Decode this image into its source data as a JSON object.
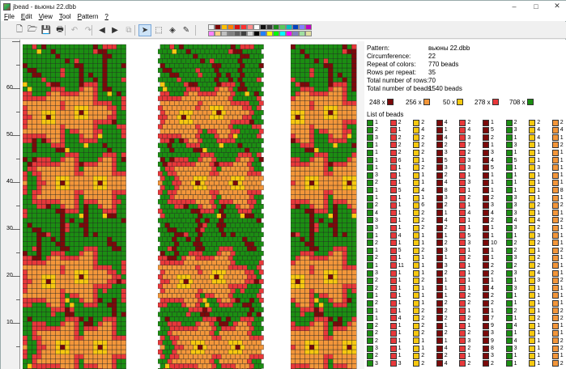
{
  "window": {
    "title": "jbead - вьюны 22.dbb"
  },
  "menu": [
    {
      "u": "F",
      "rest": "ile"
    },
    {
      "u": "E",
      "rest": "dit"
    },
    {
      "u": "V",
      "rest": "iew"
    },
    {
      "u": "T",
      "rest": "ool"
    },
    {
      "u": "P",
      "rest": "attern"
    },
    {
      "u": "?",
      "rest": ""
    }
  ],
  "toolbar": {
    "buttons": [
      "new-file-icon",
      "open-folder-icon",
      "save-icon",
      "print-icon",
      "undo-icon",
      "redo-icon",
      "scroll-left-icon",
      "scroll-right-icon",
      "copy-icon",
      "pointer-icon",
      "select-icon",
      "fill-icon",
      "pipette-icon"
    ],
    "selected": "pointer-icon",
    "palette": [
      "#f0f0f0",
      "#7a0000",
      "#ffc000",
      "#ff8000",
      "#dd1010",
      "#ff3030",
      "#ff8c8c",
      "#ffffff",
      "#111111",
      "#3a3a3a",
      "#1a8a1a",
      "#5ac85a",
      "#00c0c0",
      "#0040c0",
      "#8080ff",
      "#c000c0",
      "#ff80ff",
      "#ffd080",
      "#c0c0c0",
      "#808080",
      "#606060",
      "#404040",
      "#d8d8d8",
      "#000000",
      "#2080ff",
      "#ffff00",
      "#00ff00",
      "#00ffff",
      "#ff00ff",
      "#8080c0",
      "#a0e0a0",
      "#e0e0a0"
    ]
  },
  "colors": {
    "green": "#1b8e12",
    "darkred": "#7b0a0a",
    "orange": "#f3963a",
    "red": "#e8383a",
    "yellow": "#f7c80f",
    "white": "#ffffff"
  },
  "ruler": {
    "labels": [
      "60",
      "50",
      "40",
      "30",
      "20",
      "10"
    ]
  },
  "info": {
    "pattern_label": "Pattern:",
    "pattern": "вьюны 22.dbb",
    "circ_label": "Circumference:",
    "circ": "22",
    "repeat_label": "Repeat of colors:",
    "repeat": "770 beads",
    "rows_repeat_label": "Rows per repeat:",
    "rows_repeat": "35",
    "rows_label": "Total number of rows:",
    "rows": "70",
    "beads_label": "Total number of beads:",
    "beads": "1540 beads",
    "summary": [
      {
        "count": "248 x",
        "color": "darkred"
      },
      {
        "count": "256 x",
        "color": "orange"
      },
      {
        "count": "50 x",
        "color": "yellow"
      },
      {
        "count": "278 x",
        "color": "red"
      },
      {
        "count": "708 x",
        "color": "green"
      }
    ],
    "list_label": "List of beads",
    "list": [
      [
        [
          "green",
          "1"
        ],
        [
          "green",
          "2"
        ],
        [
          "green",
          "3"
        ],
        [
          "green",
          "1"
        ],
        [
          "green",
          "1"
        ],
        [
          "green",
          "1"
        ],
        [
          "green",
          "1"
        ],
        [
          "green",
          "3"
        ],
        [
          "green",
          "2"
        ],
        [
          "green",
          "1"
        ],
        [
          "green",
          "1"
        ],
        [
          "green",
          "2"
        ],
        [
          "green",
          "4"
        ],
        [
          "green",
          "3"
        ],
        [
          "green",
          "3"
        ],
        [
          "green",
          "1"
        ],
        [
          "green",
          "2"
        ],
        [
          "green",
          "1"
        ],
        [
          "green",
          "2"
        ],
        [
          "green",
          "1"
        ],
        [
          "green",
          "3"
        ],
        [
          "green",
          "2"
        ],
        [
          "green",
          "2"
        ],
        [
          "green",
          "1"
        ],
        [
          "green",
          "2"
        ],
        [
          "green",
          "1"
        ],
        [
          "green",
          "1"
        ],
        [
          "green",
          "2"
        ],
        [
          "green",
          "2"
        ],
        [
          "green",
          "2"
        ],
        [
          "green",
          "3"
        ],
        [
          "green",
          "2"
        ],
        [
          "green",
          "3"
        ]
      ],
      [
        [
          "red",
          "2"
        ],
        [
          "red",
          "1"
        ],
        [
          "red",
          "2"
        ],
        [
          "red",
          "2"
        ],
        [
          "red",
          "2"
        ],
        [
          "red",
          "6"
        ],
        [
          "red",
          "1"
        ],
        [
          "red",
          "1"
        ],
        [
          "red",
          "1"
        ],
        [
          "red",
          "5"
        ],
        [
          "red",
          "1"
        ],
        [
          "red",
          "1"
        ],
        [
          "red",
          "1"
        ],
        [
          "red",
          "1"
        ],
        [
          "red",
          "1"
        ],
        [
          "red",
          "4"
        ],
        [
          "red",
          "1"
        ],
        [
          "red",
          "5"
        ],
        [
          "red",
          "1"
        ],
        [
          "red",
          "11"
        ],
        [
          "red",
          "1"
        ],
        [
          "red",
          "1"
        ],
        [
          "red",
          "1"
        ],
        [
          "red",
          "1"
        ],
        [
          "red",
          "1"
        ],
        [
          "red",
          "1"
        ],
        [
          "red",
          "4"
        ],
        [
          "red",
          "1"
        ],
        [
          "red",
          "1"
        ],
        [
          "red",
          "1"
        ],
        [
          "red",
          "1"
        ],
        [
          "red",
          "1"
        ],
        [
          "red",
          "3"
        ]
      ],
      [
        [
          "yellow",
          "2"
        ],
        [
          "yellow",
          "4"
        ],
        [
          "yellow",
          "2"
        ],
        [
          "yellow",
          "2"
        ],
        [
          "yellow",
          "2"
        ],
        [
          "yellow",
          "1"
        ],
        [
          "yellow",
          "2"
        ],
        [
          "yellow",
          "1"
        ],
        [
          "yellow",
          "1"
        ],
        [
          "yellow",
          "4"
        ],
        [
          "yellow",
          "1"
        ],
        [
          "yellow",
          "6"
        ],
        [
          "yellow",
          "2"
        ],
        [
          "yellow",
          "2"
        ],
        [
          "yellow",
          "2"
        ],
        [
          "yellow",
          "1"
        ],
        [
          "yellow",
          "1"
        ],
        [
          "yellow",
          "2"
        ],
        [
          "yellow",
          "1"
        ],
        [
          "yellow",
          "1"
        ],
        [
          "yellow",
          "1"
        ],
        [
          "yellow",
          "2"
        ],
        [
          "yellow",
          "1"
        ],
        [
          "yellow",
          "1"
        ],
        [
          "yellow",
          "1"
        ],
        [
          "yellow",
          "2"
        ],
        [
          "yellow",
          "2"
        ],
        [
          "yellow",
          "2"
        ],
        [
          "yellow",
          "2"
        ],
        [
          "yellow",
          "1"
        ],
        [
          "yellow",
          "1"
        ],
        [
          "yellow",
          "2"
        ],
        [
          "yellow",
          "2"
        ]
      ],
      [
        [
          "darkred",
          "4"
        ],
        [
          "darkred",
          "1"
        ],
        [
          "darkred",
          "4"
        ],
        [
          "darkred",
          "2"
        ],
        [
          "darkred",
          "3"
        ],
        [
          "darkred",
          "5"
        ],
        [
          "darkred",
          "3"
        ],
        [
          "darkred",
          "2"
        ],
        [
          "darkred",
          "4"
        ],
        [
          "darkred",
          "8"
        ],
        [
          "darkred",
          "3"
        ],
        [
          "darkred",
          "2"
        ],
        [
          "darkred",
          "1"
        ],
        [
          "darkred",
          "4"
        ],
        [
          "darkred",
          "2"
        ],
        [
          "darkred",
          "1"
        ],
        [
          "darkred",
          "2"
        ],
        [
          "darkred",
          "3"
        ],
        [
          "darkred",
          "1"
        ],
        [
          "darkred",
          "3"
        ],
        [
          "darkred",
          "2"
        ],
        [
          "darkred",
          "1"
        ],
        [
          "darkred",
          "1"
        ],
        [
          "darkred",
          "1"
        ],
        [
          "darkred",
          "2"
        ],
        [
          "darkred",
          "2"
        ],
        [
          "darkred",
          "2"
        ],
        [
          "darkred",
          "1"
        ],
        [
          "darkred",
          "2"
        ],
        [
          "darkred",
          "1"
        ],
        [
          "darkred",
          "4"
        ],
        [
          "darkred",
          "2"
        ],
        [
          "darkred",
          "4"
        ]
      ],
      [
        [
          "red",
          "2"
        ],
        [
          "red",
          "4"
        ],
        [
          "red",
          "3"
        ],
        [
          "red",
          "7"
        ],
        [
          "red",
          "2"
        ],
        [
          "red",
          "3"
        ],
        [
          "red",
          "3"
        ],
        [
          "red",
          "1"
        ],
        [
          "red",
          "3"
        ],
        [
          "red",
          "1"
        ],
        [
          "red",
          "2"
        ],
        [
          "red",
          "1"
        ],
        [
          "red",
          "4"
        ],
        [
          "red",
          "1"
        ],
        [
          "red",
          "1"
        ],
        [
          "red",
          "5"
        ],
        [
          "red",
          "3"
        ],
        [
          "red",
          "1"
        ],
        [
          "red",
          "2"
        ],
        [
          "red",
          "1"
        ],
        [
          "red",
          "1"
        ],
        [
          "red",
          "1"
        ],
        [
          "red",
          "1"
        ],
        [
          "red",
          "2"
        ],
        [
          "red",
          "2"
        ],
        [
          "red",
          "1"
        ],
        [
          "red",
          "2"
        ],
        [
          "red",
          "1"
        ],
        [
          "red",
          "2"
        ],
        [
          "red",
          "3"
        ],
        [
          "red",
          "2"
        ],
        [
          "red",
          "1"
        ],
        [
          "red",
          "2"
        ]
      ],
      [
        [
          "darkred",
          "1"
        ],
        [
          "darkred",
          "5"
        ],
        [
          "darkred",
          "2"
        ],
        [
          "darkred",
          "1"
        ],
        [
          "darkred",
          "3"
        ],
        [
          "darkred",
          "4"
        ],
        [
          "darkred",
          "5"
        ],
        [
          "darkred",
          "1"
        ],
        [
          "darkred",
          "1"
        ],
        [
          "darkred",
          "1"
        ],
        [
          "darkred",
          "2"
        ],
        [
          "darkred",
          "3"
        ],
        [
          "darkred",
          "4"
        ],
        [
          "darkred",
          "2"
        ],
        [
          "darkred",
          "1"
        ],
        [
          "darkred",
          "1"
        ],
        [
          "darkred",
          "10"
        ],
        [
          "darkred",
          "1"
        ],
        [
          "darkred",
          "1"
        ],
        [
          "darkred",
          "2"
        ],
        [
          "darkred",
          "2"
        ],
        [
          "darkred",
          "1"
        ],
        [
          "darkred",
          "4"
        ],
        [
          "darkred",
          "2"
        ],
        [
          "darkred",
          "2"
        ],
        [
          "darkred",
          "1"
        ],
        [
          "darkred",
          "7"
        ],
        [
          "darkred",
          "9"
        ],
        [
          "darkred",
          "3"
        ],
        [
          "darkred",
          "9"
        ],
        [
          "darkred",
          "8"
        ],
        [
          "darkred",
          "3"
        ],
        [
          "darkred",
          "2"
        ]
      ],
      [
        [
          "green",
          "2"
        ],
        [
          "green",
          "3"
        ],
        [
          "green",
          "1"
        ],
        [
          "green",
          "3"
        ],
        [
          "green",
          "1"
        ],
        [
          "green",
          "5"
        ],
        [
          "green",
          "1"
        ],
        [
          "green",
          "1"
        ],
        [
          "green",
          "1"
        ],
        [
          "green",
          "1"
        ],
        [
          "green",
          "3"
        ],
        [
          "green",
          "3"
        ],
        [
          "green",
          "3"
        ],
        [
          "green",
          "4"
        ],
        [
          "green",
          "3"
        ],
        [
          "green",
          "1"
        ],
        [
          "green",
          "2"
        ],
        [
          "green",
          "2"
        ],
        [
          "green",
          "3"
        ],
        [
          "green",
          "2"
        ],
        [
          "green",
          "3"
        ],
        [
          "green",
          "1"
        ],
        [
          "green",
          "3"
        ],
        [
          "green",
          "1"
        ],
        [
          "green",
          "1"
        ],
        [
          "green",
          "2"
        ],
        [
          "green",
          "1"
        ],
        [
          "green",
          "4"
        ],
        [
          "green",
          "1"
        ],
        [
          "green",
          "4"
        ],
        [
          "green",
          "3"
        ],
        [
          "green",
          "1"
        ],
        [
          "green",
          "1"
        ]
      ],
      [
        [
          "yellow",
          "2"
        ],
        [
          "yellow",
          "4"
        ],
        [
          "yellow",
          "4"
        ],
        [
          "yellow",
          "1"
        ],
        [
          "yellow",
          "1"
        ],
        [
          "yellow",
          "1"
        ],
        [
          "yellow",
          "3"
        ],
        [
          "yellow",
          "1"
        ],
        [
          "yellow",
          "1"
        ],
        [
          "yellow",
          "1"
        ],
        [
          "yellow",
          "1"
        ],
        [
          "yellow",
          "2"
        ],
        [
          "yellow",
          "1"
        ],
        [
          "yellow",
          "4"
        ],
        [
          "yellow",
          "2"
        ],
        [
          "yellow",
          "3"
        ],
        [
          "yellow",
          "2"
        ],
        [
          "yellow",
          "1"
        ],
        [
          "yellow",
          "2"
        ],
        [
          "yellow",
          "2"
        ],
        [
          "yellow",
          "4"
        ],
        [
          "yellow",
          "3"
        ],
        [
          "yellow",
          "1"
        ],
        [
          "yellow",
          "1"
        ],
        [
          "yellow",
          "1"
        ],
        [
          "yellow",
          "1"
        ],
        [
          "yellow",
          "2"
        ],
        [
          "yellow",
          "1"
        ],
        [
          "yellow",
          "1"
        ],
        [
          "yellow",
          "1"
        ],
        [
          "yellow",
          "1"
        ],
        [
          "yellow",
          "1"
        ],
        [
          "yellow",
          "1"
        ]
      ],
      [
        [
          "orange",
          "2"
        ],
        [
          "orange",
          "4"
        ],
        [
          "orange",
          "1"
        ],
        [
          "orange",
          "2"
        ],
        [
          "orange",
          "1"
        ],
        [
          "orange",
          "1"
        ],
        [
          "orange",
          "1"
        ],
        [
          "orange",
          "1"
        ],
        [
          "orange",
          "1"
        ],
        [
          "orange",
          "8"
        ],
        [
          "orange",
          "1"
        ],
        [
          "orange",
          "2"
        ],
        [
          "orange",
          "1"
        ],
        [
          "orange",
          "2"
        ],
        [
          "orange",
          "1"
        ],
        [
          "orange",
          "1"
        ],
        [
          "orange",
          "1"
        ],
        [
          "orange",
          "2"
        ],
        [
          "orange",
          "1"
        ],
        [
          "orange",
          "1"
        ],
        [
          "orange",
          "1"
        ],
        [
          "orange",
          "2"
        ],
        [
          "orange",
          "1"
        ],
        [
          "orange",
          "1"
        ],
        [
          "orange",
          "1"
        ],
        [
          "orange",
          "2"
        ],
        [
          "orange",
          "2"
        ],
        [
          "orange",
          "1"
        ],
        [
          "orange",
          "1"
        ],
        [
          "orange",
          "2"
        ],
        [
          "orange",
          "2"
        ],
        [
          "orange",
          "1"
        ],
        [
          "orange",
          "2"
        ]
      ]
    ]
  }
}
